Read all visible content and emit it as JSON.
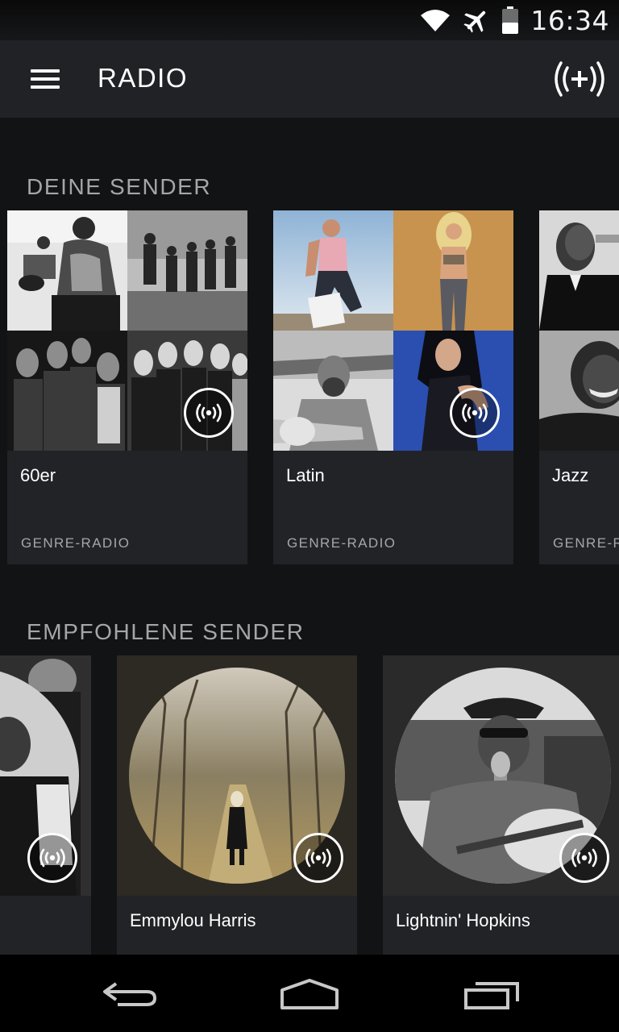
{
  "status_bar": {
    "time": "16:34",
    "icons": [
      "wifi-icon",
      "airplane-mode-icon",
      "battery-icon"
    ]
  },
  "app_bar": {
    "title": "RADIO",
    "menu_icon": "hamburger-menu-icon",
    "action_icon": "create-station-icon"
  },
  "sections": {
    "your_stations": {
      "title": "DEINE SENDER",
      "cards": [
        {
          "title": "60er",
          "subtitle": "GENRE-RADIO"
        },
        {
          "title": "Latin",
          "subtitle": "GENRE-RADIO"
        },
        {
          "title": "Jazz",
          "subtitle": "GENRE-RADIO"
        }
      ]
    },
    "recommended": {
      "title": "EMPFOHLENE SENDER",
      "cards": [
        {
          "title": ""
        },
        {
          "title": "Emmylou Harris"
        },
        {
          "title": "Lightnin' Hopkins"
        }
      ]
    }
  },
  "nav_bar": {
    "buttons": [
      "back-icon",
      "home-icon",
      "recent-apps-icon"
    ]
  },
  "colors": {
    "background": "#121314",
    "card": "#222327",
    "app_bar": "#212226",
    "secondary_text": "#a4a6a9"
  }
}
